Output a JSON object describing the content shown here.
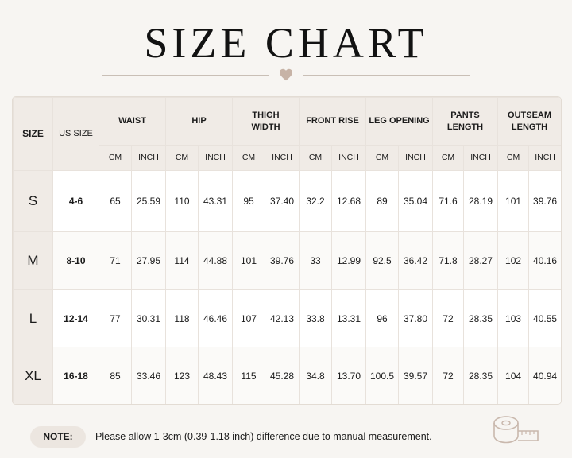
{
  "title": "SIZE CHART",
  "table": {
    "size_header": "SIZE",
    "us_size_header": "US SIZE",
    "measure_groups": [
      {
        "line1": "WAIST",
        "line2": ""
      },
      {
        "line1": "HIP",
        "line2": ""
      },
      {
        "line1": "THIGH",
        "line2": "WIDTH"
      },
      {
        "line1": "FRONT RISE",
        "line2": ""
      },
      {
        "line1": "LEG OPENING",
        "line2": ""
      },
      {
        "line1": "PANTS",
        "line2": "LENGTH"
      },
      {
        "line1": "OUTSEAM",
        "line2": "LENGTH"
      }
    ],
    "units": [
      "CM",
      "INCH"
    ],
    "rows": [
      {
        "size": "S",
        "us": "4-6",
        "values": [
          "65",
          "25.59",
          "110",
          "43.31",
          "95",
          "37.40",
          "32.2",
          "12.68",
          "89",
          "35.04",
          "71.6",
          "28.19",
          "101",
          "39.76"
        ]
      },
      {
        "size": "M",
        "us": "8-10",
        "values": [
          "71",
          "27.95",
          "114",
          "44.88",
          "101",
          "39.76",
          "33",
          "12.99",
          "92.5",
          "36.42",
          "71.8",
          "28.27",
          "102",
          "40.16"
        ]
      },
      {
        "size": "L",
        "us": "12-14",
        "values": [
          "77",
          "30.31",
          "118",
          "46.46",
          "107",
          "42.13",
          "33.8",
          "13.31",
          "96",
          "37.80",
          "72",
          "28.35",
          "103",
          "40.55"
        ]
      },
      {
        "size": "XL",
        "us": "16-18",
        "values": [
          "85",
          "33.46",
          "123",
          "48.43",
          "115",
          "45.28",
          "34.8",
          "13.70",
          "100.5",
          "39.57",
          "72",
          "28.35",
          "104",
          "40.94"
        ]
      }
    ]
  },
  "note": {
    "label": "NOTE:",
    "text": "Please allow 1-3cm (0.39-1.18 inch) difference due to manual measurement."
  },
  "icons": {
    "divider": "heart-icon",
    "corner": "measuring-tape-icon"
  },
  "colors": {
    "header_bg": "#f0ebe6",
    "accent": "#c7b3a6"
  }
}
